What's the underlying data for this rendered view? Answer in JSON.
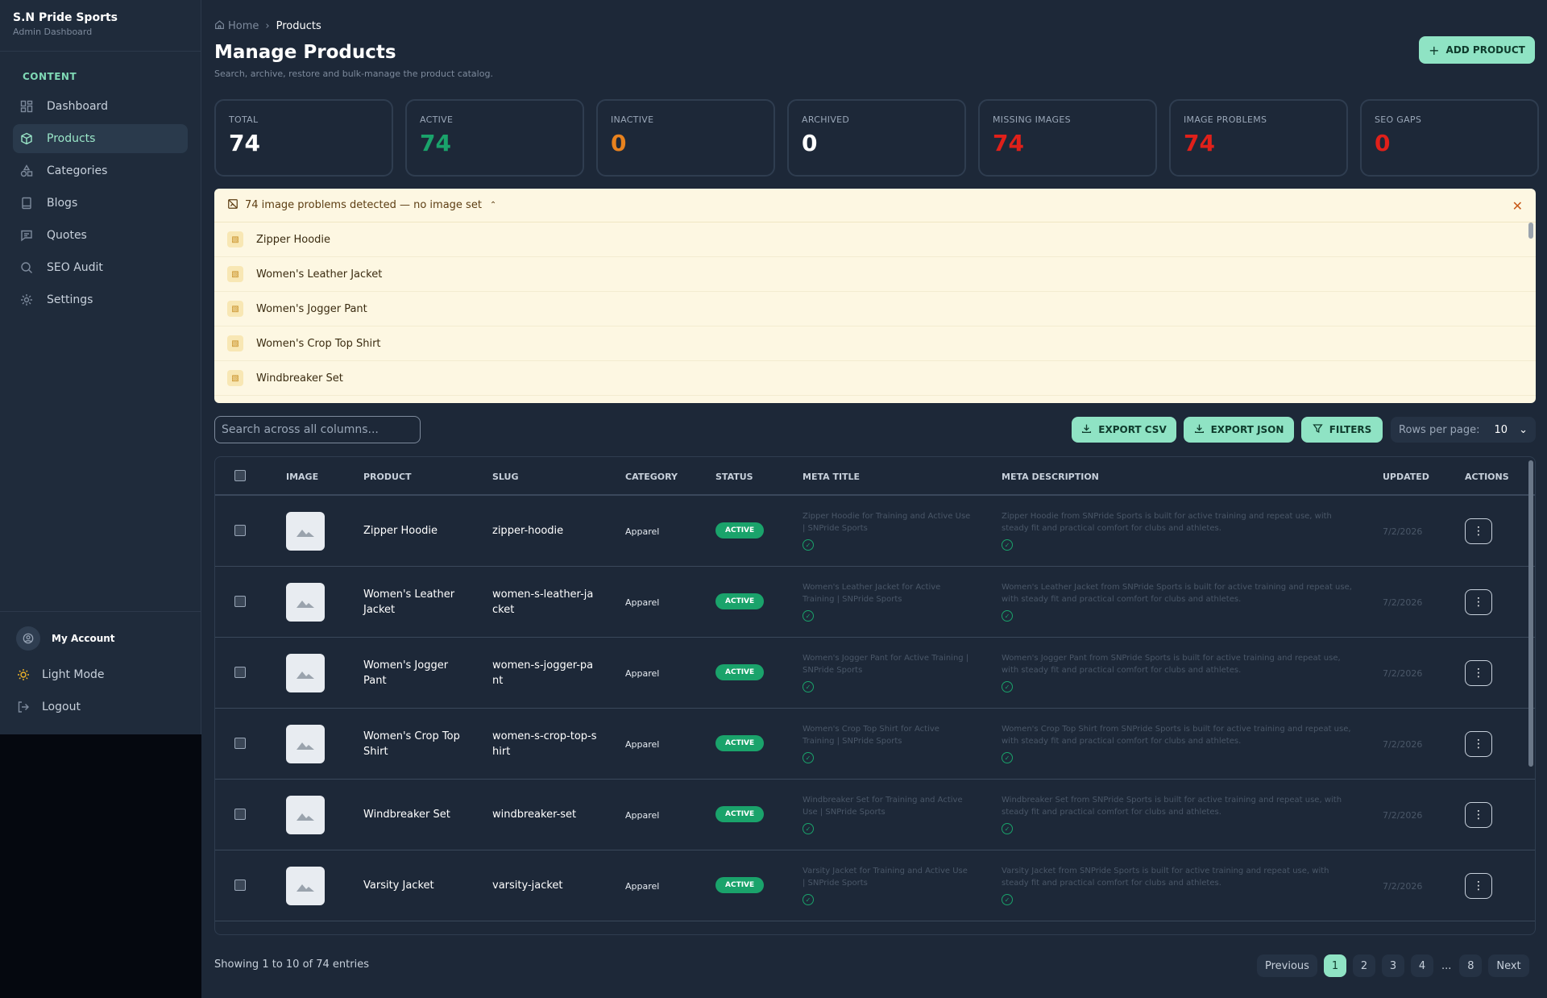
{
  "brand": {
    "name": "S.N Pride Sports",
    "sub": "Admin Dashboard"
  },
  "sidebar": {
    "section": "CONTENT",
    "items": [
      {
        "label": "Dashboard",
        "icon": "dashboard-icon"
      },
      {
        "label": "Products",
        "icon": "box-icon",
        "active": true
      },
      {
        "label": "Categories",
        "icon": "shapes-icon"
      },
      {
        "label": "Blogs",
        "icon": "book-icon"
      },
      {
        "label": "Quotes",
        "icon": "message-icon"
      },
      {
        "label": "SEO Audit",
        "icon": "search-icon"
      },
      {
        "label": "Settings",
        "icon": "gear-icon"
      }
    ],
    "account": "My Account",
    "light_mode": "Light Mode",
    "logout": "Logout"
  },
  "breadcrumb": {
    "home": "Home",
    "current": "Products"
  },
  "header": {
    "title": "Manage Products",
    "subtitle": "Search, archive, restore and bulk-manage the product catalog.",
    "add_button": "ADD PRODUCT"
  },
  "stats": [
    {
      "label": "TOTAL",
      "value": "74",
      "color": "#ffffff"
    },
    {
      "label": "ACTIVE",
      "value": "74",
      "color": "#1aa36b"
    },
    {
      "label": "INACTIVE",
      "value": "0",
      "color": "#e8821e"
    },
    {
      "label": "ARCHIVED",
      "value": "0",
      "color": "#ffffff"
    },
    {
      "label": "MISSING IMAGES",
      "value": "74",
      "color": "#e0201a"
    },
    {
      "label": "IMAGE PROBLEMS",
      "value": "74",
      "color": "#e0201a"
    },
    {
      "label": "SEO GAPS",
      "value": "0",
      "color": "#e0201a"
    }
  ],
  "alert": {
    "title": "74 image problems detected — no image set",
    "items": [
      "Zipper Hoodie",
      "Women's Leather Jacket",
      "Women's Jogger Pant",
      "Women's Crop Top Shirt",
      "Windbreaker Set"
    ]
  },
  "toolbar": {
    "search_placeholder": "Search across all columns...",
    "export_csv": "EXPORT CSV",
    "export_json": "EXPORT JSON",
    "filters": "FILTERS",
    "rows_label": "Rows per page:",
    "rows_value": "10"
  },
  "table": {
    "headers": [
      "IMAGE",
      "PRODUCT",
      "SLUG",
      "CATEGORY",
      "STATUS",
      "META TITLE",
      "META DESCRIPTION",
      "UPDATED",
      "ACTIONS"
    ],
    "rows": [
      {
        "product": "Zipper Hoodie",
        "slug": "zipper-hoodie",
        "category": "Apparel",
        "status": "ACTIVE",
        "meta_title": "Zipper Hoodie for Training and Active Use | SNPride Sports",
        "meta_description": "Zipper Hoodie from SNPride Sports is built for active training and repeat use, with steady fit and practical comfort for clubs and athletes.",
        "updated": "7/2/2026"
      },
      {
        "product": "Women's Leather Jacket",
        "slug": "women-s-leather-jacket",
        "category": "Apparel",
        "status": "ACTIVE",
        "meta_title": "Women's Leather Jacket for Active Training | SNPride Sports",
        "meta_description": "Women's Leather Jacket from SNPride Sports is built for active training and repeat use, with steady fit and practical comfort for clubs and athletes.",
        "updated": "7/2/2026"
      },
      {
        "product": "Women's Jogger Pant",
        "slug": "women-s-jogger-pant",
        "category": "Apparel",
        "status": "ACTIVE",
        "meta_title": "Women's Jogger Pant for Active Training | SNPride Sports",
        "meta_description": "Women's Jogger Pant from SNPride Sports is built for active training and repeat use, with steady fit and practical comfort for clubs and athletes.",
        "updated": "7/2/2026"
      },
      {
        "product": "Women's Crop Top Shirt",
        "slug": "women-s-crop-top-shirt",
        "category": "Apparel",
        "status": "ACTIVE",
        "meta_title": "Women's Crop Top Shirt for Active Training | SNPride Sports",
        "meta_description": "Women's Crop Top Shirt from SNPride Sports is built for active training and repeat use, with steady fit and practical comfort for clubs and athletes.",
        "updated": "7/2/2026"
      },
      {
        "product": "Windbreaker Set",
        "slug": "windbreaker-set",
        "category": "Apparel",
        "status": "ACTIVE",
        "meta_title": "Windbreaker Set for Training and Active Use | SNPride Sports",
        "meta_description": "Windbreaker Set from SNPride Sports is built for active training and repeat use, with steady fit and practical comfort for clubs and athletes.",
        "updated": "7/2/2026"
      },
      {
        "product": "Varsity Jacket",
        "slug": "varsity-jacket",
        "category": "Apparel",
        "status": "ACTIVE",
        "meta_title": "Varsity Jacket for Training and Active Use | SNPride Sports",
        "meta_description": "Varsity Jacket from SNPride Sports is built for active training and repeat use, with steady fit and practical comfort for clubs and athletes.",
        "updated": "7/2/2026"
      }
    ]
  },
  "footer": {
    "info": "Showing 1 to 10 of 74 entries",
    "previous": "Previous",
    "next": "Next",
    "pages": [
      "1",
      "2",
      "3",
      "4",
      "...",
      "8"
    ],
    "current_page": "1"
  }
}
